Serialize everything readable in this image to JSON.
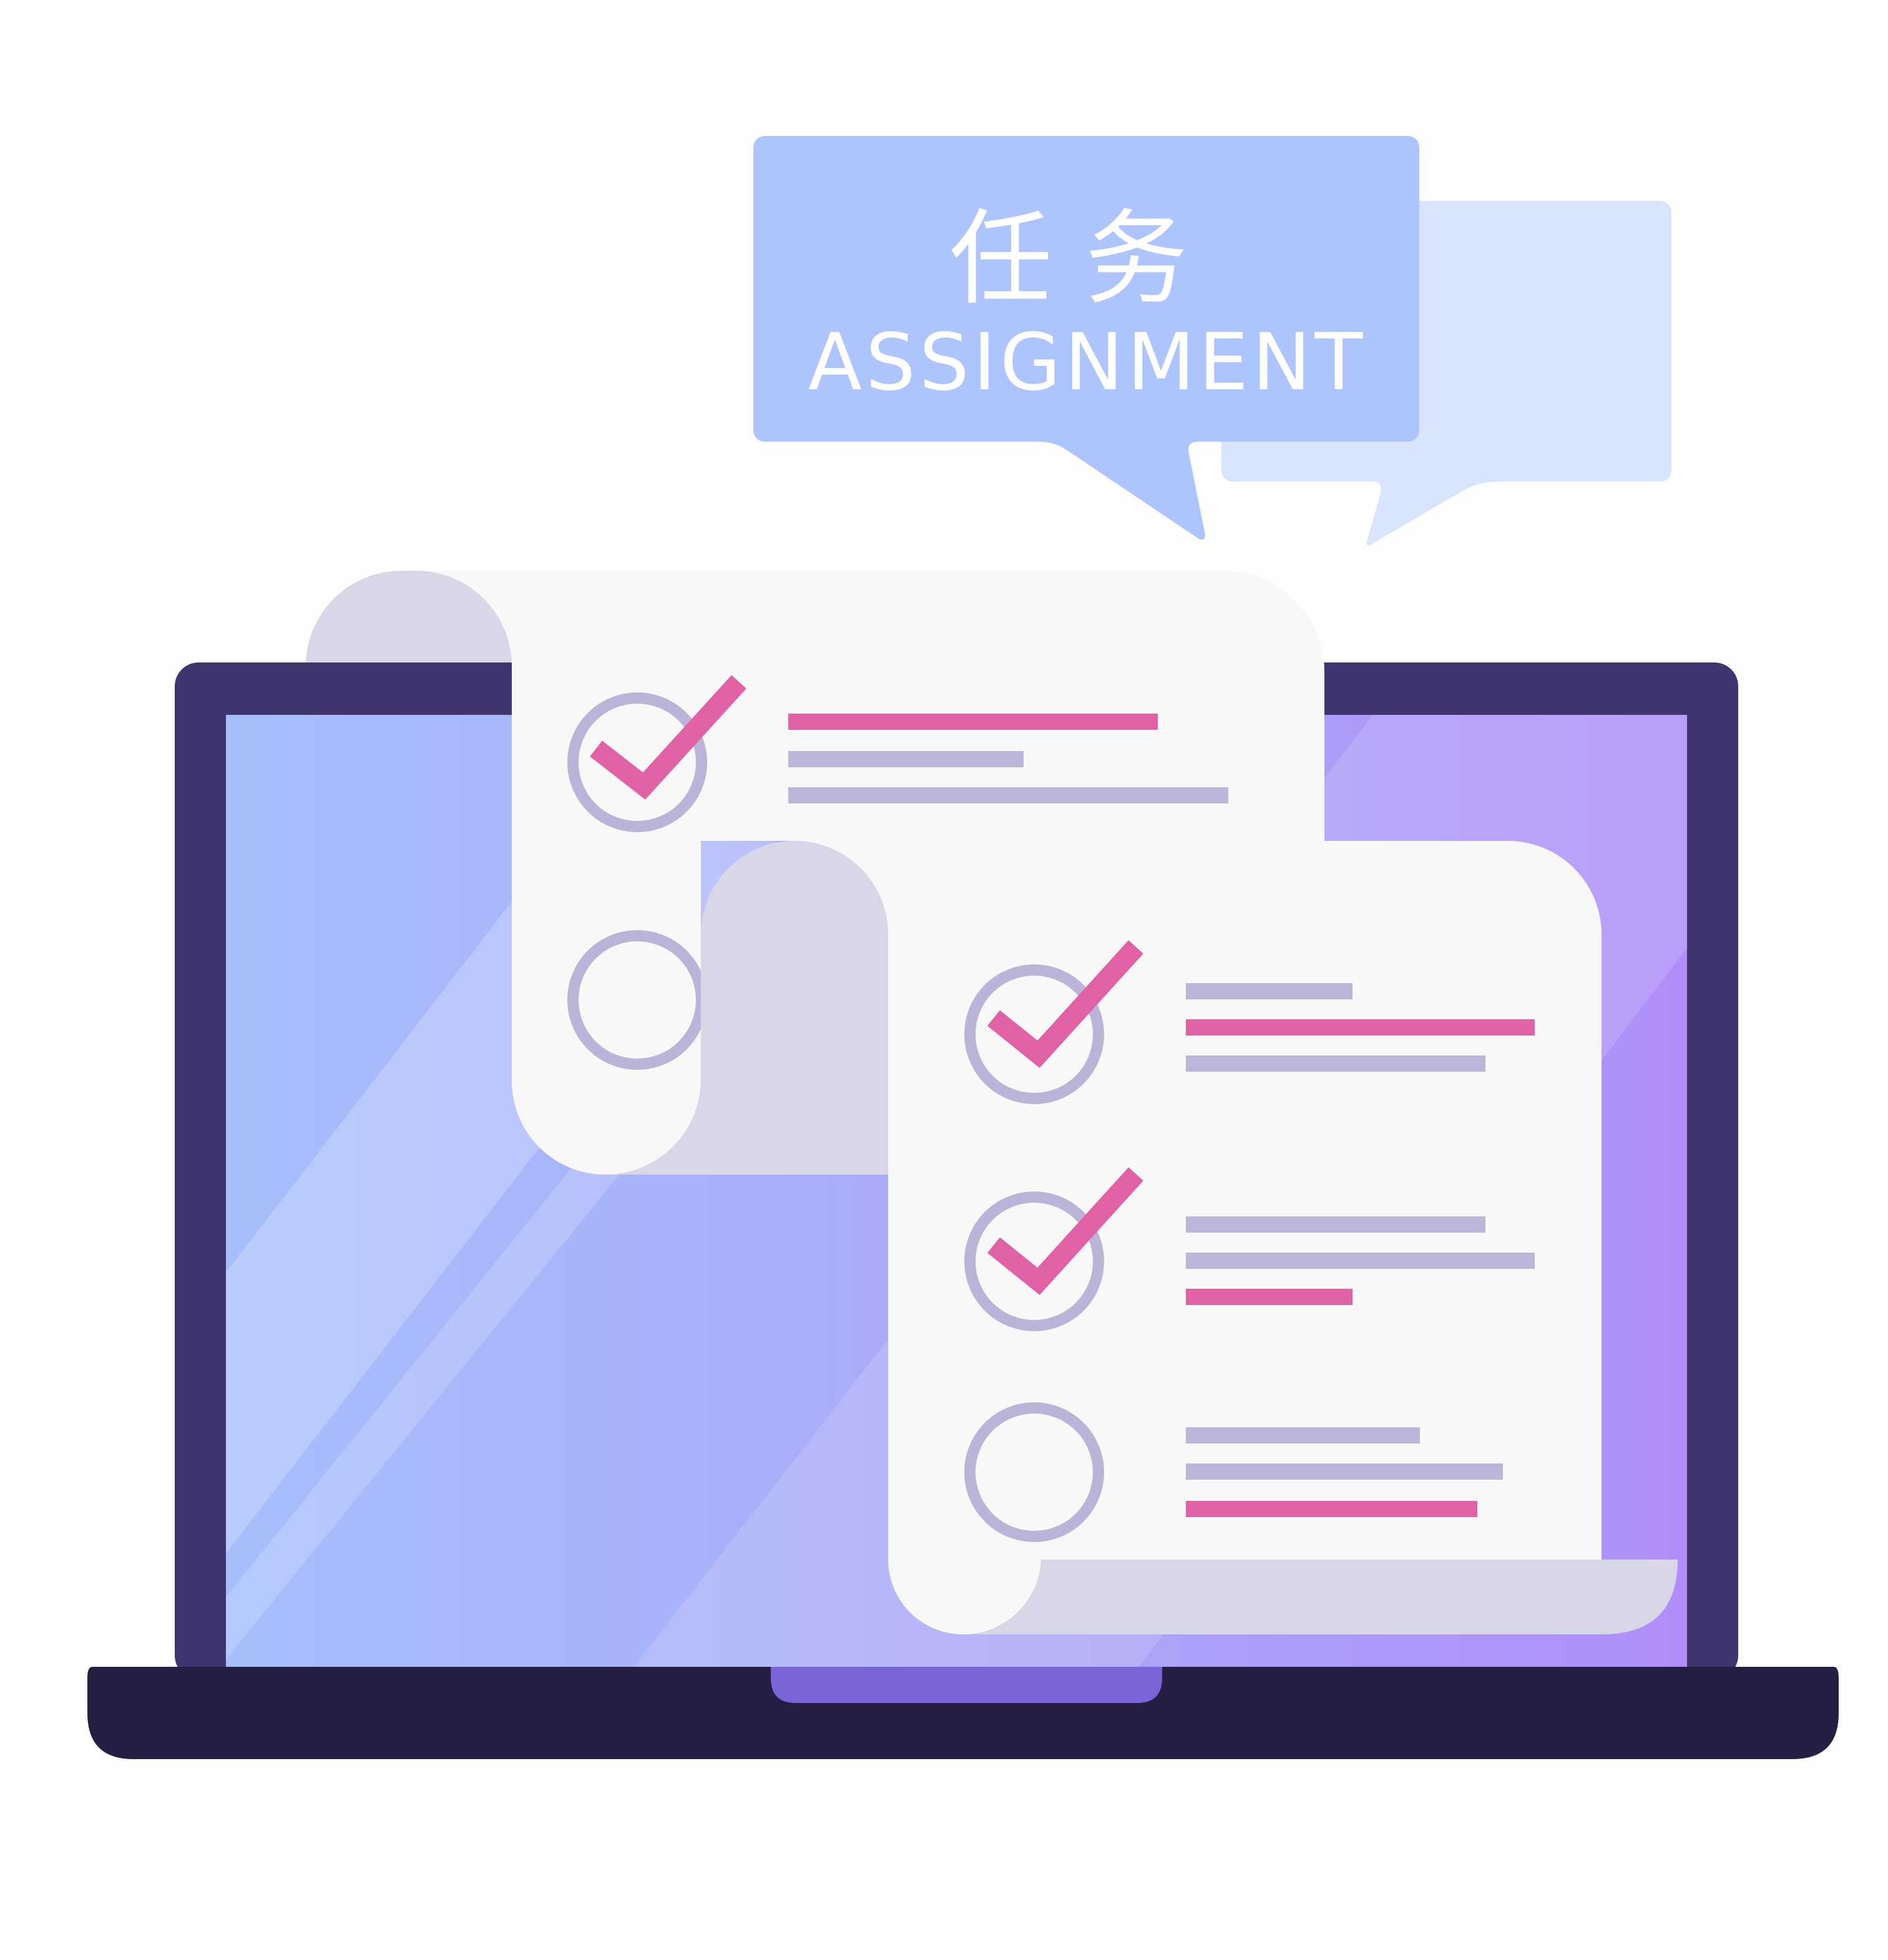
{
  "bubble": {
    "title_cn": "任 务",
    "title_en": "ASSIGNMENT"
  },
  "checklist_front": {
    "items": [
      {
        "checked": true
      },
      {
        "checked": true
      },
      {
        "checked": false
      }
    ]
  },
  "checklist_back": {
    "items": [
      {
        "checked": true
      },
      {
        "checked": false
      }
    ]
  },
  "colors": {
    "laptop_frame": "#40356e",
    "laptop_base": "#261f45",
    "laptop_notch": "#7b64d8",
    "bubble_main": "#aec4fc",
    "bubble_back": "#d9e4fd",
    "paper": "#f8f8f8",
    "paper_fold": "#d8d7e7",
    "check_pink": "#e062a4",
    "line_lavender": "#bbb5d9",
    "circle_outline": "#bcb3d8"
  }
}
